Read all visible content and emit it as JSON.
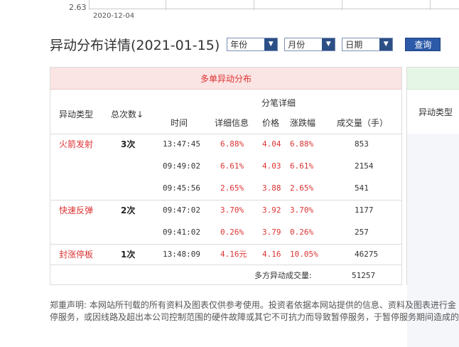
{
  "chart_strip": {
    "axis_value": "2.63",
    "axis_date": "2020-12-04"
  },
  "header": {
    "title": "异动分布详情(2021-01-15)",
    "select_year": "年份",
    "select_month": "月份",
    "select_day": "日期",
    "query_label": "查询"
  },
  "panel": {
    "heading": "多单异动分布",
    "col_type": "异动类型",
    "col_count": "总次数",
    "sort_icon": "↓",
    "col_group": "分笔详细",
    "col_time": "时间",
    "col_detail": "详细信息",
    "col_price": "价格",
    "col_change": "涨跌幅",
    "col_volume": "成交量（手）",
    "groups": [
      {
        "type": "火箭发射",
        "count": "3次",
        "rows": [
          {
            "time": "13:47:45",
            "detail": "6.88%",
            "price": "4.04",
            "change": "6.88%",
            "volume": "853"
          },
          {
            "time": "09:49:02",
            "detail": "6.61%",
            "price": "4.03",
            "change": "6.61%",
            "volume": "2154"
          },
          {
            "time": "09:45:56",
            "detail": "2.65%",
            "price": "3.88",
            "change": "2.65%",
            "volume": "541"
          }
        ]
      },
      {
        "type": "快速反弹",
        "count": "2次",
        "rows": [
          {
            "time": "09:47:02",
            "detail": "3.70%",
            "price": "3.92",
            "change": "3.70%",
            "volume": "1177"
          },
          {
            "time": "09:41:02",
            "detail": "0.26%",
            "price": "3.79",
            "change": "0.26%",
            "volume": "257"
          }
        ]
      },
      {
        "type": "封涨停板",
        "count": "1次",
        "rows": [
          {
            "time": "13:48:09",
            "detail": "4.16元",
            "price": "4.16",
            "change": "10.05%",
            "volume": "46275"
          }
        ]
      }
    ],
    "total_label": "多方异动成交量:",
    "total_value": "51257"
  },
  "panel2": {
    "col_type": "异动类型"
  },
  "disclaimer": {
    "line1": "郑重声明: 本网站所刊载的所有资料及图表仅供参考使用。投资者依据本网站提供的信息、资料及图表进行金",
    "line2": "停服务，或因线路及超出本公司控制范围的硬件故障或其它不可抗力而导致暂停服务，于暂停服务期间造成的"
  }
}
